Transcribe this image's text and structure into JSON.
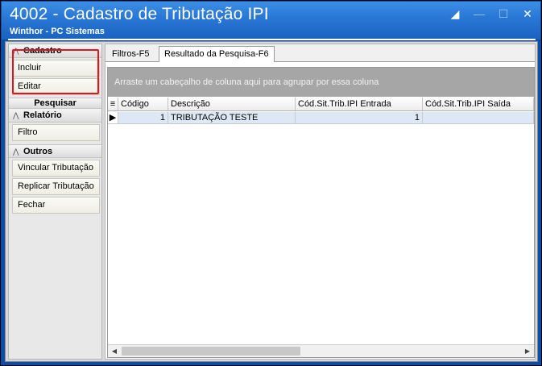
{
  "window": {
    "title": "4002 - Cadastro de Tributação IPI",
    "subtitle": "Winthor - PC Sistemas",
    "controls": [
      "restore-icon",
      "minimize-icon",
      "maximize-icon",
      "close-icon"
    ]
  },
  "sidebar": {
    "groups": [
      {
        "label": "Cadastro",
        "items": [
          "Incluir",
          "Editar"
        ]
      },
      {
        "label": "Pesquisar",
        "items": []
      },
      {
        "label": "Relatório",
        "items": [
          "Filtro"
        ]
      },
      {
        "label": "Outros",
        "items": [
          "Vincular Tributação",
          "Replicar Tributação",
          "Fechar"
        ]
      }
    ]
  },
  "tabs": {
    "filtros": "Filtros-F5",
    "resultado": "Resultado da Pesquisa-F6",
    "active": "resultado"
  },
  "grid": {
    "group_panel_text": "Arraste um cabeçalho de coluna aqui para agrupar por essa coluna",
    "columns": [
      "Código",
      "Descrição",
      "Cód.Sit.Trib.IPI Entrada",
      "Cód.Sit.Trib.IPI Saída"
    ],
    "rows": [
      {
        "codigo": "1",
        "descricao": "TRIBUTAÇÃO TESTE",
        "entrada": "1",
        "saida": ""
      }
    ]
  },
  "colors": {
    "title_bar": "#2a78d6",
    "highlight": "#e3141c",
    "group_panel": "#a6a6a6"
  }
}
